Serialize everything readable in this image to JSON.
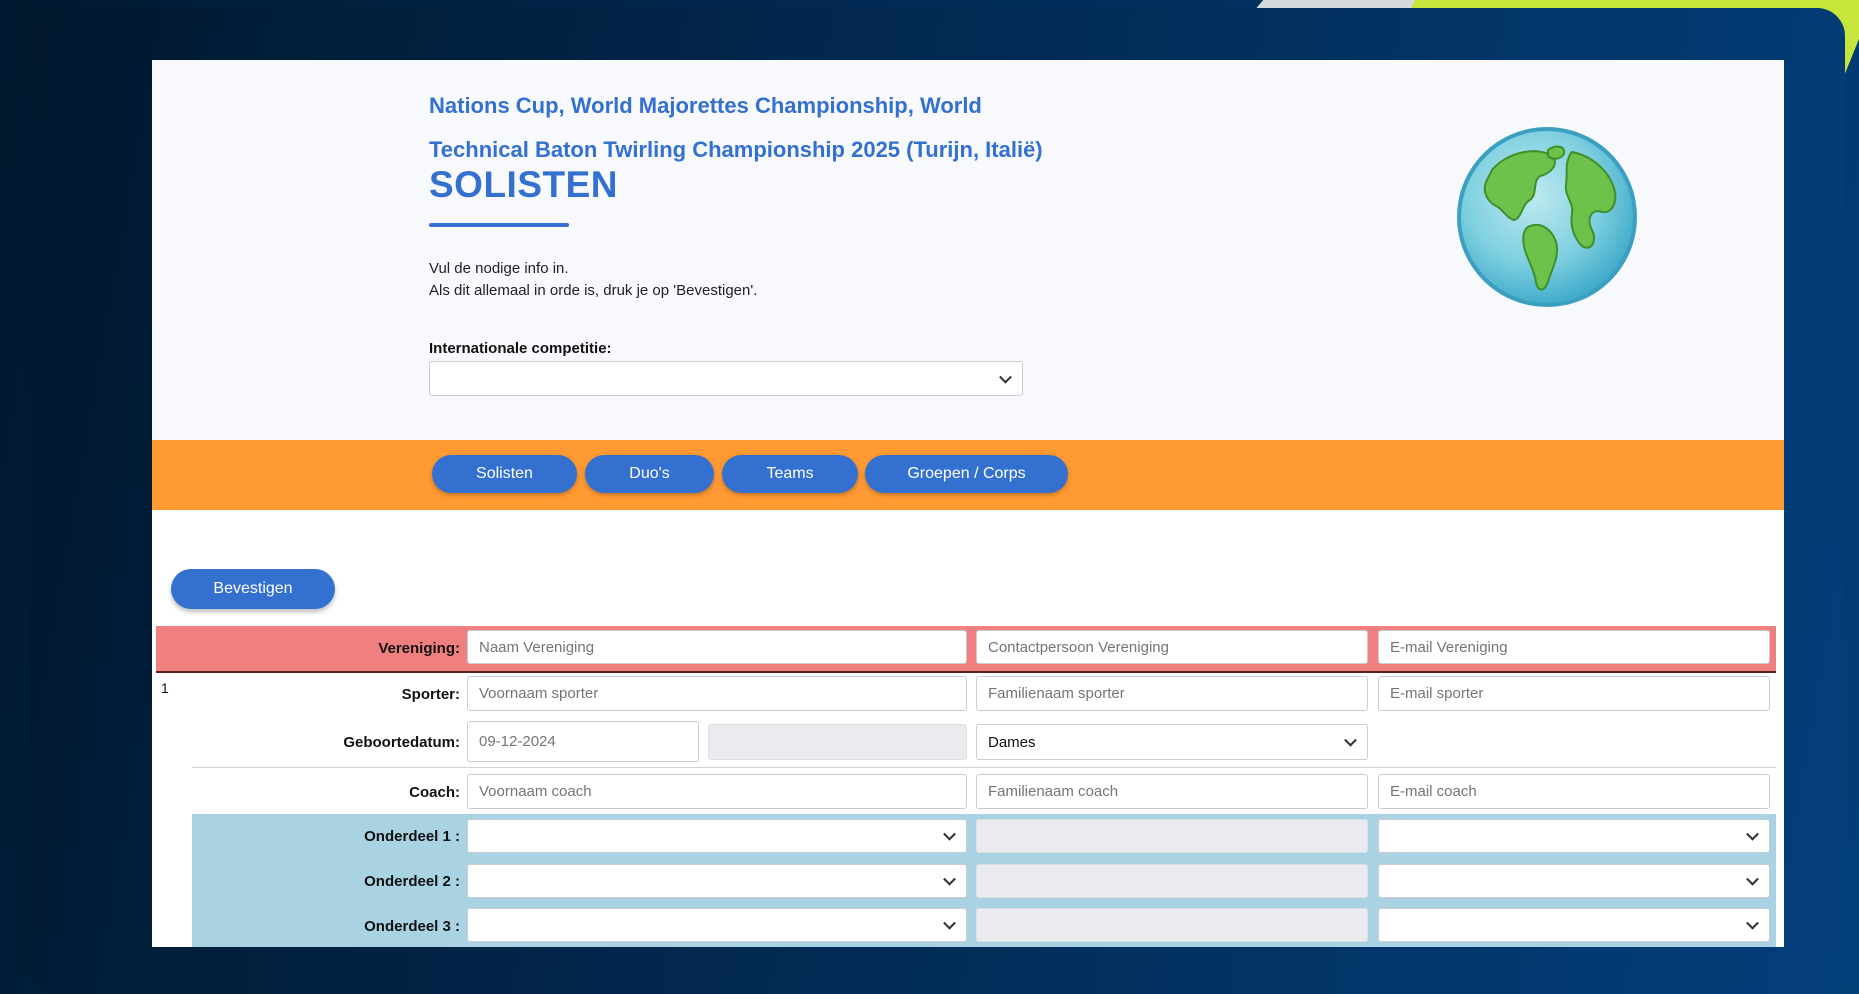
{
  "header": {
    "title": "Nations Cup, World Majorettes Championship, World Technical Baton Twirling Championship 2025 (Turijn, Italië)",
    "heading": "SOLISTEN",
    "intro_line1": "Vul de nodige info in.",
    "intro_line2": "Als dit allemaal in orde is, druk je op 'Bevestigen'.",
    "competition_label": "Internationale competitie:",
    "competition_value": ""
  },
  "nav": {
    "solisten": "Solisten",
    "duos": "Duo's",
    "teams": "Teams",
    "groepen": "Groepen / Corps"
  },
  "form": {
    "confirm_label": "Bevestigen",
    "club": {
      "label": "Vereniging:",
      "name_placeholder": "Naam Vereniging",
      "contact_placeholder": "Contactpersoon Vereniging",
      "email_placeholder": "E-mail Vereniging"
    },
    "entry_number": "1",
    "athlete": {
      "label": "Sporter:",
      "first_placeholder": "Voornaam sporter",
      "last_placeholder": "Familienaam sporter",
      "email_placeholder": "E-mail sporter"
    },
    "birth": {
      "label": "Geboortedatum:",
      "date_placeholder": "09-12-2024",
      "gender_value": "Dames"
    },
    "coach": {
      "label": "Coach:",
      "first_placeholder": "Voornaam coach",
      "last_placeholder": "Familienaam coach",
      "email_placeholder": "E-mail coach"
    },
    "disciplines": [
      {
        "label": "Onderdeel 1 :"
      },
      {
        "label": "Onderdeel 2 :"
      },
      {
        "label": "Onderdeel 3 :"
      }
    ]
  },
  "colors": {
    "brand_blue": "#3470cf",
    "nav_orange": "#ff9a33",
    "club_row": "#f08080",
    "discipline_area": "#a9d3e3"
  }
}
